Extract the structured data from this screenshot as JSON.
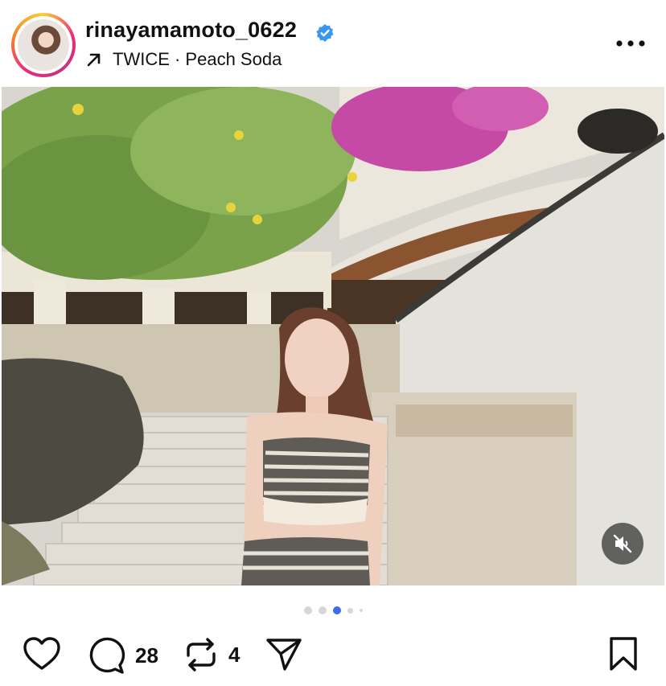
{
  "header": {
    "username": "rinayamamoto_0622",
    "verified": true,
    "music": "TWICE · Peach Soda",
    "music_icon": "arrow-up-right-icon",
    "more_icon": "more-horizontal-icon"
  },
  "media": {
    "mute_icon": "speaker-muted-icon",
    "carousel": {
      "count": 5,
      "active_index": 2
    }
  },
  "actions": {
    "like_icon": "heart-icon",
    "comment_icon": "comment-icon",
    "comment_count": "28",
    "repost_icon": "repost-icon",
    "repost_count": "4",
    "share_icon": "send-icon",
    "save_icon": "bookmark-icon"
  },
  "colors": {
    "verified_blue": "#3897f0",
    "active_dot": "#3f6be8",
    "inactive_dot": "#d6d6d6",
    "text": "#111111"
  }
}
